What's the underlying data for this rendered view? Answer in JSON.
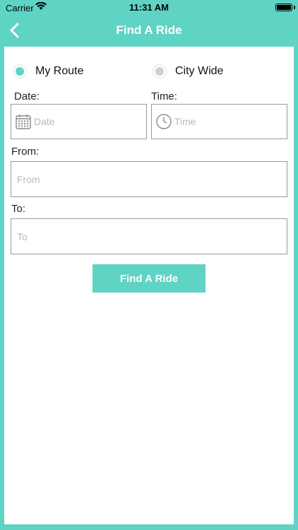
{
  "status": {
    "carrier": "Carrier",
    "time": "11:31 AM"
  },
  "nav": {
    "title": "Find A Ride"
  },
  "route_options": [
    {
      "label": "My Route",
      "selected": true
    },
    {
      "label": "City Wide",
      "selected": false
    }
  ],
  "form": {
    "date_label": "Date:",
    "date_placeholder": "Date",
    "time_label": "Time:",
    "time_placeholder": "Time",
    "from_label": "From:",
    "from_placeholder": "From",
    "to_label": "To:",
    "to_placeholder": "To"
  },
  "action": {
    "find_label": "Find A Ride"
  },
  "colors": {
    "accent": "#5fd3c4",
    "radio_selected": "#5fd3c4",
    "radio_unselected": "#cfcfcf",
    "border": "#9a9a9a",
    "placeholder": "#b9b9b9"
  }
}
